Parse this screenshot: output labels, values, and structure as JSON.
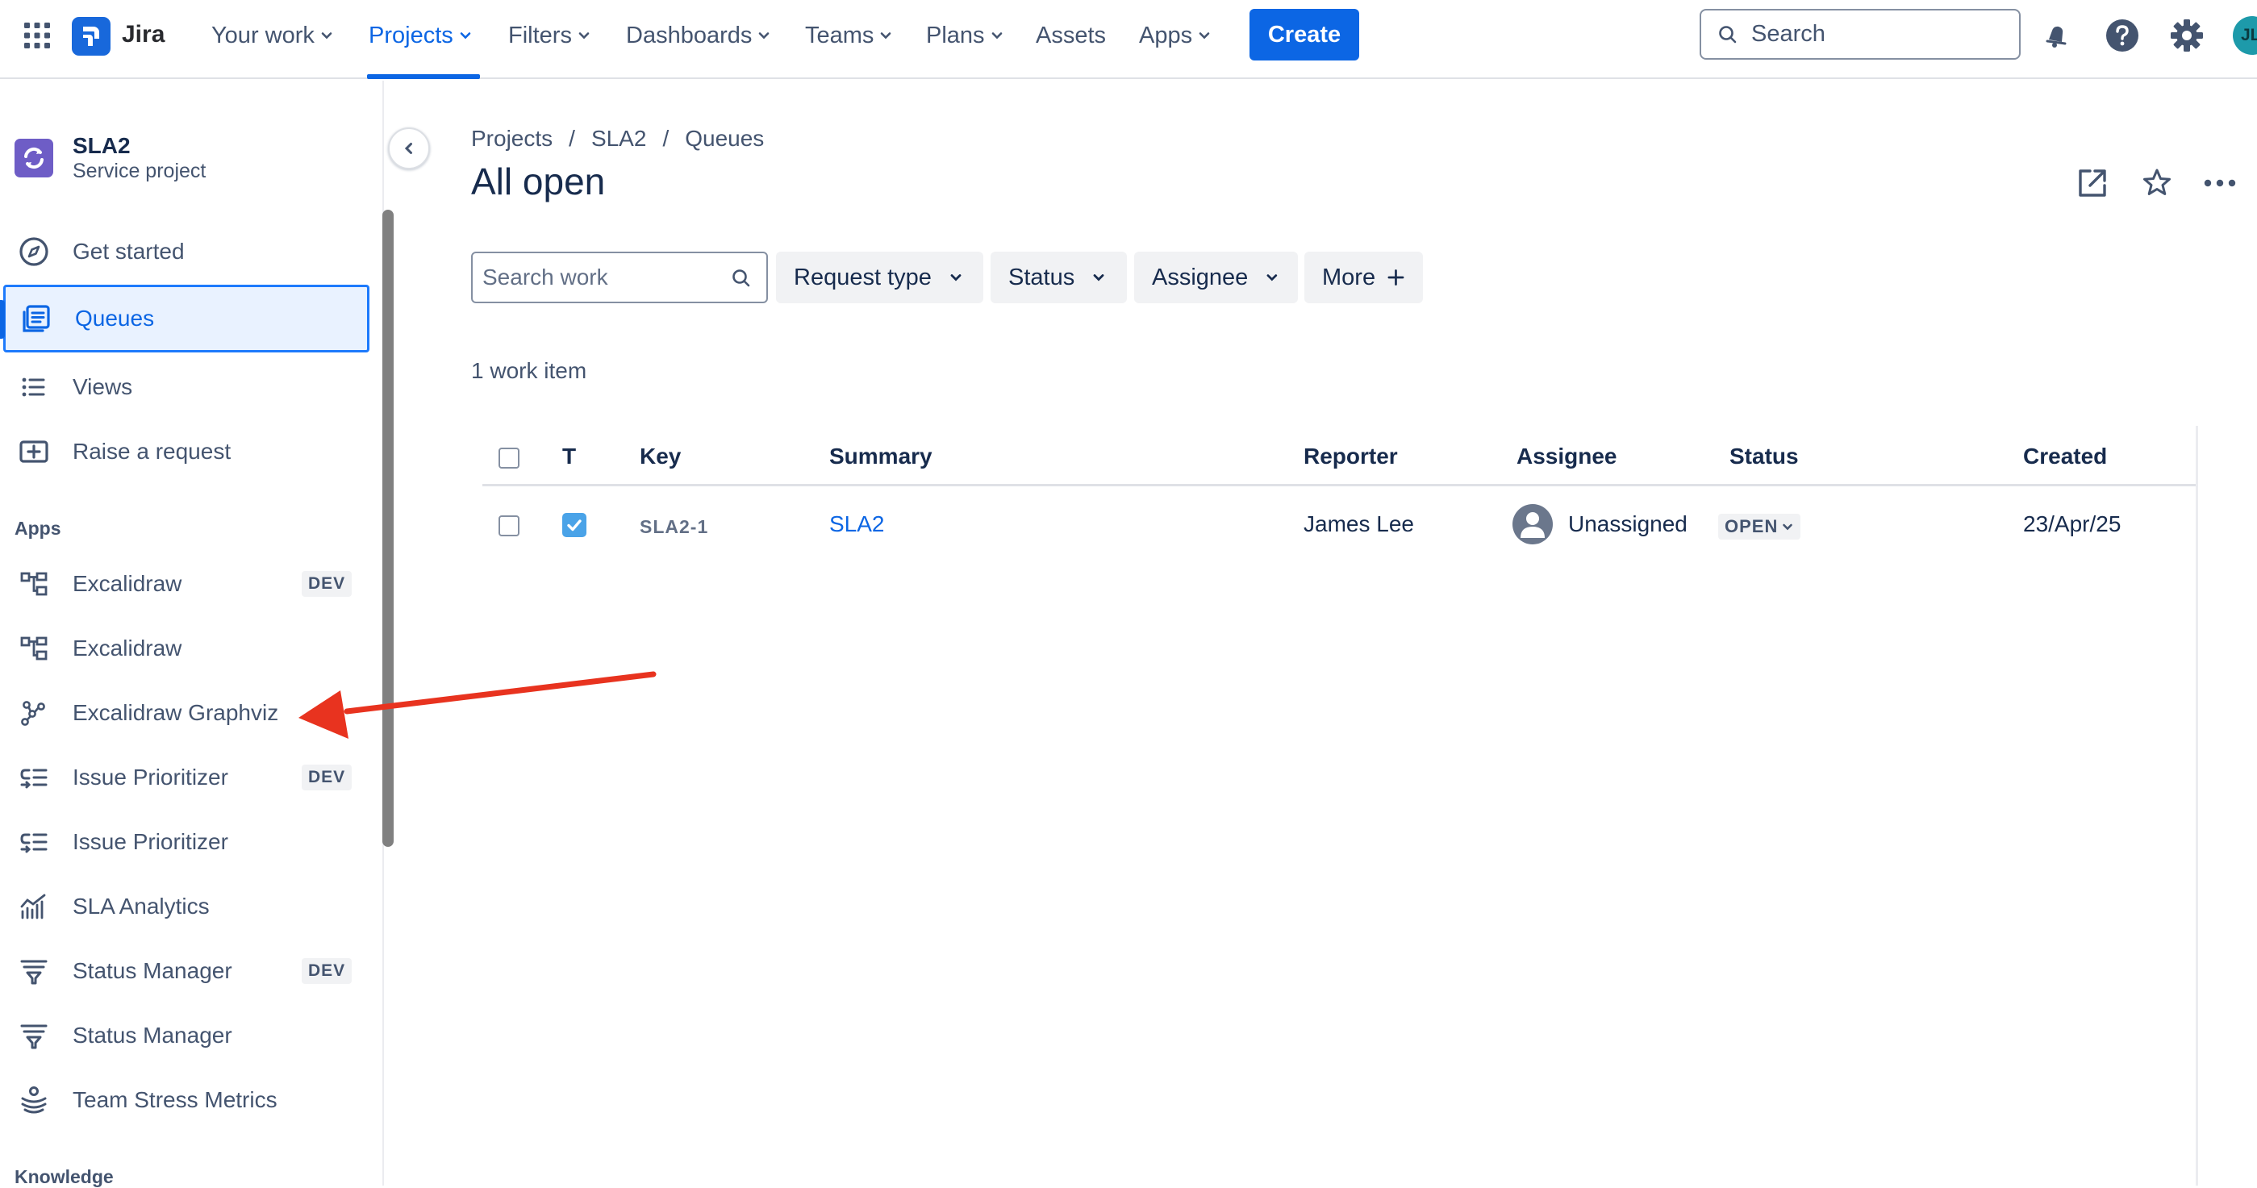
{
  "topnav": {
    "app_name": "Jira",
    "items": [
      {
        "label": "Your work"
      },
      {
        "label": "Projects"
      },
      {
        "label": "Filters"
      },
      {
        "label": "Dashboards"
      },
      {
        "label": "Teams"
      },
      {
        "label": "Plans"
      },
      {
        "label": "Assets"
      },
      {
        "label": "Apps"
      }
    ],
    "create_label": "Create",
    "search_placeholder": "Search",
    "avatar_initials": "JL",
    "colors": {
      "accent": "#0c66e4",
      "avatar": "#1d9aaa"
    }
  },
  "project": {
    "name": "SLA2",
    "type": "Service project"
  },
  "sidebar": {
    "items": [
      {
        "label": "Get started",
        "icon": "compass-icon"
      },
      {
        "label": "Queues",
        "icon": "queue-icon"
      },
      {
        "label": "Views",
        "icon": "list-icon"
      },
      {
        "label": "Raise a request",
        "icon": "plus-square-icon"
      }
    ],
    "apps_heading": "Apps",
    "apps": [
      {
        "label": "Excalidraw",
        "badge": "DEV",
        "icon": "diagram-icon"
      },
      {
        "label": "Excalidraw",
        "badge": "",
        "icon": "diagram-icon"
      },
      {
        "label": "Excalidraw Graphviz",
        "badge": "",
        "icon": "graph-icon"
      },
      {
        "label": "Issue Prioritizer",
        "badge": "DEV",
        "icon": "prioritizer-icon"
      },
      {
        "label": "Issue Prioritizer",
        "badge": "",
        "icon": "prioritizer-icon"
      },
      {
        "label": "SLA Analytics",
        "badge": "",
        "icon": "analytics-icon"
      },
      {
        "label": "Status Manager",
        "badge": "DEV",
        "icon": "funnel-icon"
      },
      {
        "label": "Status Manager",
        "badge": "",
        "icon": "funnel-icon"
      },
      {
        "label": "Team Stress Metrics",
        "badge": "",
        "icon": "stress-icon"
      }
    ],
    "knowledge_heading": "Knowledge"
  },
  "main": {
    "breadcrumb": [
      "Projects",
      "SLA2",
      "Queues"
    ],
    "title": "All open",
    "search_placeholder": "Search work",
    "filters": [
      "Request type",
      "Status",
      "Assignee",
      "More"
    ],
    "count_text": "1 work item",
    "table": {
      "headers": [
        "T",
        "Key",
        "Summary",
        "Reporter",
        "Assignee",
        "Status",
        "Created"
      ],
      "rows": [
        {
          "key": "SLA2-1",
          "summary": "SLA2",
          "reporter": "James Lee",
          "assignee": "Unassigned",
          "status": "OPEN",
          "created": "23/Apr/25"
        }
      ]
    }
  }
}
